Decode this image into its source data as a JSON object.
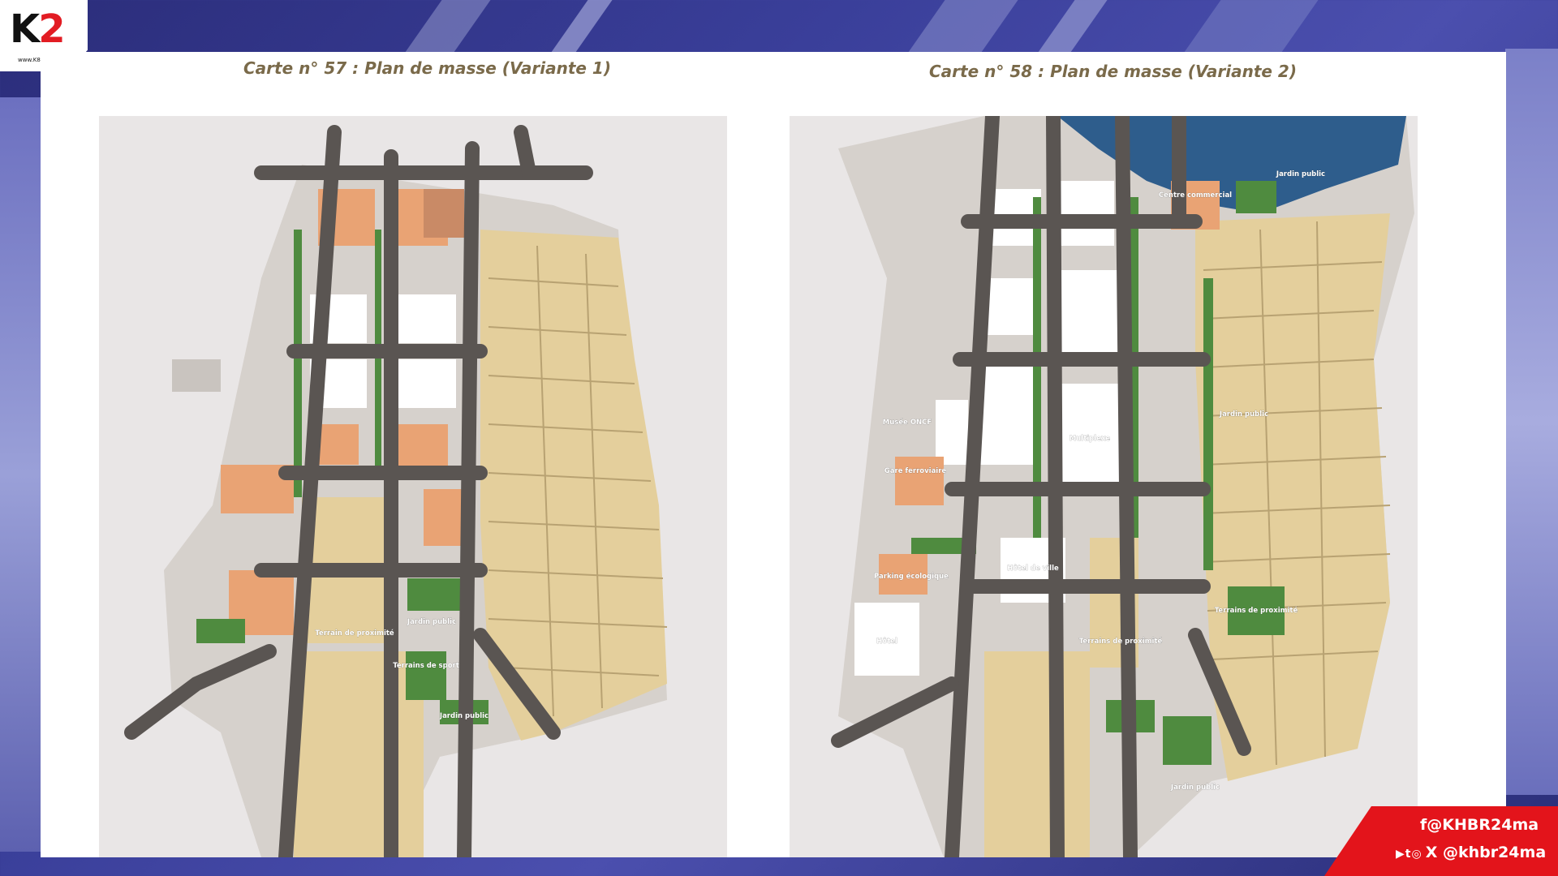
{
  "logo": {
    "mark": "K",
    "mark_accent": "2",
    "url": "www.K8.ma"
  },
  "slide": {
    "left_caption": "Carte n° 57 : Plan de masse (Variante 1)",
    "right_caption": "Carte n° 58 : Plan de masse (Variante 2)"
  },
  "map1": {
    "labels": [
      "Jardin public",
      "Terrains de sport",
      "Terrain de proximité",
      "Jardin public"
    ]
  },
  "map2": {
    "labels": [
      "Jardin public",
      "Multiplexe",
      "Hôtel de ville",
      "Terrains de proximité",
      "Terrains de proximité",
      "Jardin public",
      "Jardin public",
      "Musée ONCF",
      "Gare ferroviaire",
      "Parking écologique",
      "Hôtel",
      "Centre commercial"
    ]
  },
  "social": {
    "facebook": "f@KHBR24ma",
    "icons": "▶t◎",
    "x_handle": "X @khbr24ma"
  },
  "colors": {
    "road": "#5a5552",
    "block": "#e4cf9c",
    "orange": "#e9a374",
    "green": "#4f8b3f",
    "accent_red": "#e3141b"
  }
}
